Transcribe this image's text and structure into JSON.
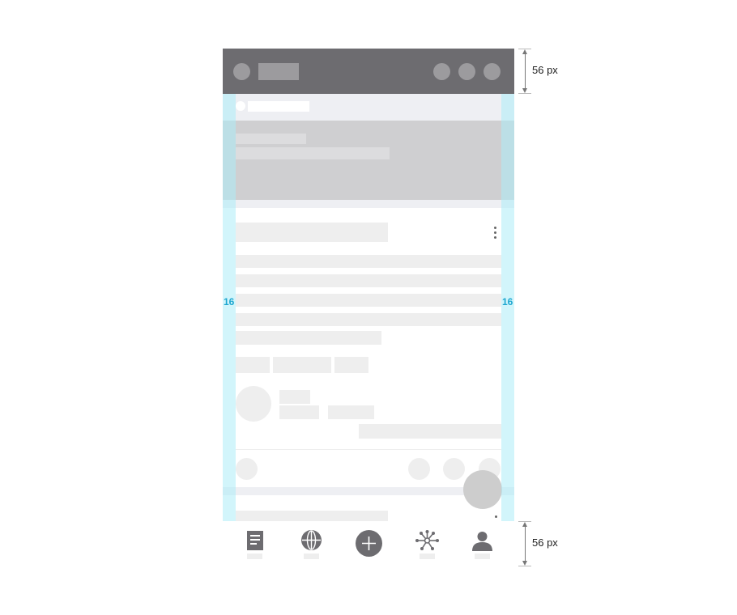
{
  "annotations": {
    "appbar_height": "56 px",
    "bottomnav_height": "56 px",
    "left_margin": "16",
    "right_margin": "16"
  },
  "colors": {
    "appbar": "#6d6c70",
    "placeholder": "#eeeeee",
    "margin_guide": "#adecf8",
    "banner": "#cfcfd1",
    "guide_text": "#1ea7d0"
  },
  "bottom_nav": {
    "items": [
      {
        "icon": "document-icon"
      },
      {
        "icon": "globe-icon"
      },
      {
        "icon": "add-icon"
      },
      {
        "icon": "network-icon"
      },
      {
        "icon": "profile-icon"
      }
    ]
  }
}
